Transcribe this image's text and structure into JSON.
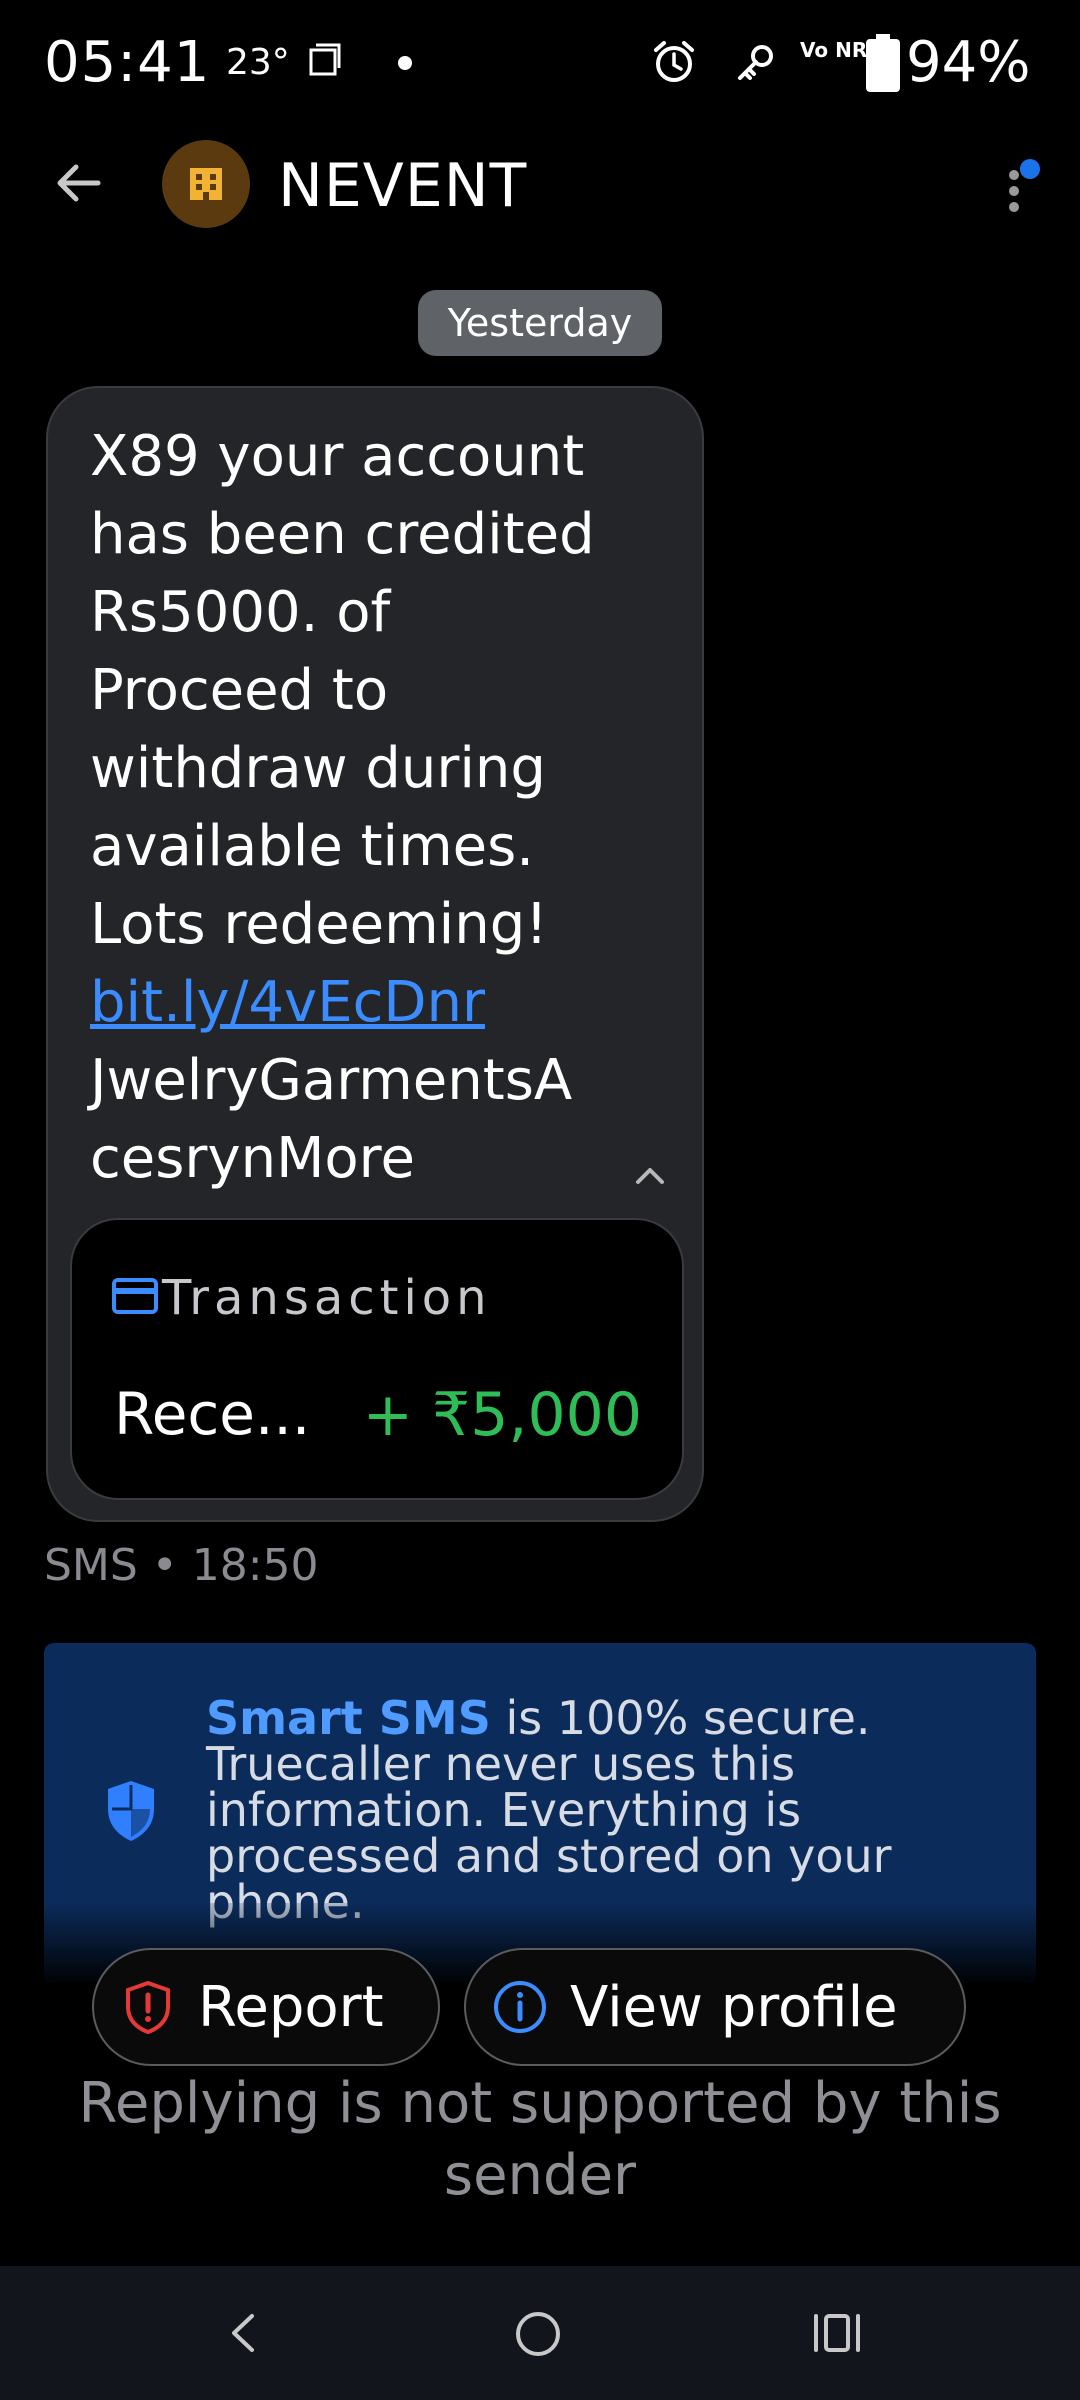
{
  "status_bar": {
    "time": "05:41",
    "temperature": "23°",
    "battery": "94%",
    "network": "Vo NR"
  },
  "app_bar": {
    "sender": "NEVENT"
  },
  "conversation": {
    "date_label": "Yesterday",
    "message": {
      "text_before_link": "X89 your account\nhas been credited\nRs5000. of\nProceed to\nwithdraw during\navailable times.\nLots redeeming!\n",
      "link": "bit.ly/4vEcDnr",
      "text_after_link": "\nJwelryGarmentsA\ncesrynMore"
    },
    "transaction_card": {
      "title": "Transaction",
      "description": "Rece...",
      "amount": "+ ₹5,000"
    },
    "meta": "SMS • 18:50"
  },
  "smart_sms": {
    "highlight": "Smart SMS",
    "text": " is 100% secure. Truecaller never uses this information. Everything is processed and stored on your phone."
  },
  "actions": {
    "report_label": "Report",
    "view_profile_label": "View profile"
  },
  "reply_note": "Replying is not supported by this sender",
  "colors": {
    "accent_blue": "#3b8dff",
    "credit_green": "#2fbd57",
    "report_red": "#e53935",
    "panel_blue": "#0b2b5a"
  }
}
